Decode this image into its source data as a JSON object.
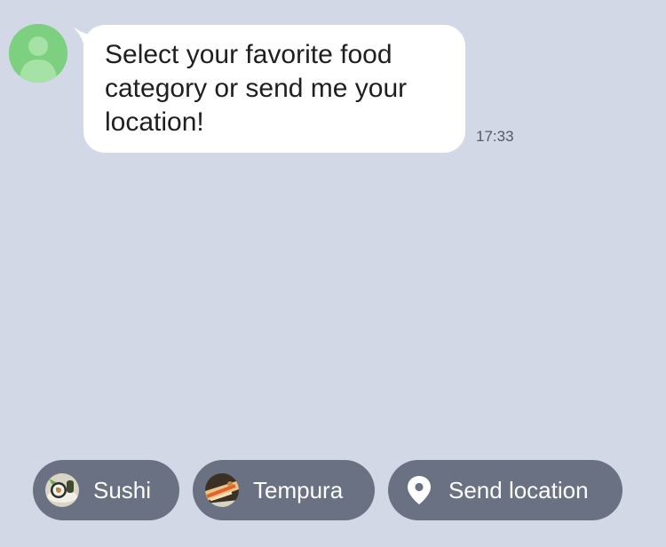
{
  "chat": {
    "message": {
      "text": "Select your favorite food category or send me your location!",
      "time": "17:33",
      "sender_avatar": "person-silhouette-icon"
    }
  },
  "quick_replies": [
    {
      "label": "Sushi",
      "icon": "sushi-thumbnail"
    },
    {
      "label": "Tempura",
      "icon": "tempura-thumbnail"
    },
    {
      "label": "Send location",
      "icon": "location-pin-icon"
    }
  ],
  "colors": {
    "background": "#d3d8e7",
    "bubble": "#ffffff",
    "avatar": "#7cd07f",
    "quick_reply": "#6a7183"
  }
}
